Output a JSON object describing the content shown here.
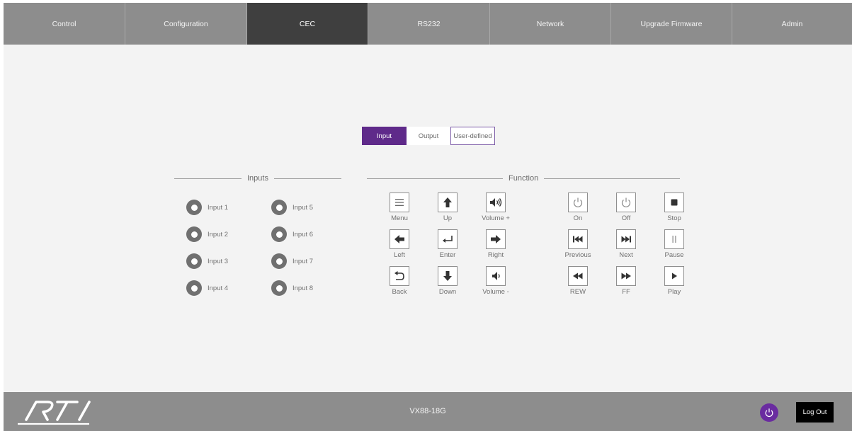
{
  "nav": {
    "tabs": [
      {
        "label": "Control"
      },
      {
        "label": "Configuration"
      },
      {
        "label": "CEC",
        "active": true
      },
      {
        "label": "RS232"
      },
      {
        "label": "Network"
      },
      {
        "label": "Upgrade Firmware"
      },
      {
        "label": "Admin"
      }
    ]
  },
  "mode_tabs": {
    "input": "Input",
    "output": "Output",
    "user_defined": "User-defined",
    "selected": "Input"
  },
  "inputs": {
    "title": "Inputs",
    "items": [
      "Input 1",
      "Input 2",
      "Input 3",
      "Input 4",
      "Input 5",
      "Input 6",
      "Input 7",
      "Input 8"
    ]
  },
  "function": {
    "title": "Function",
    "buttons": {
      "menu": "Menu",
      "up": "Up",
      "volume_up": "Volume +",
      "left": "Left",
      "enter": "Enter",
      "right": "Right",
      "back": "Back",
      "down": "Down",
      "volume_down": "Volume -",
      "on": "On",
      "off": "Off",
      "stop": "Stop",
      "previous": "Previous",
      "next": "Next",
      "pause": "Pause",
      "rew": "REW",
      "ff": "FF",
      "play": "Play"
    }
  },
  "footer": {
    "logo": "RTI",
    "model": "VX88-18G",
    "logout": "Log Out"
  },
  "colors": {
    "accent": "#5f2a8a",
    "nav_bg": "#8d8d8d",
    "nav_active": "#3f3f3f",
    "page_bg": "#f3f3f3"
  }
}
